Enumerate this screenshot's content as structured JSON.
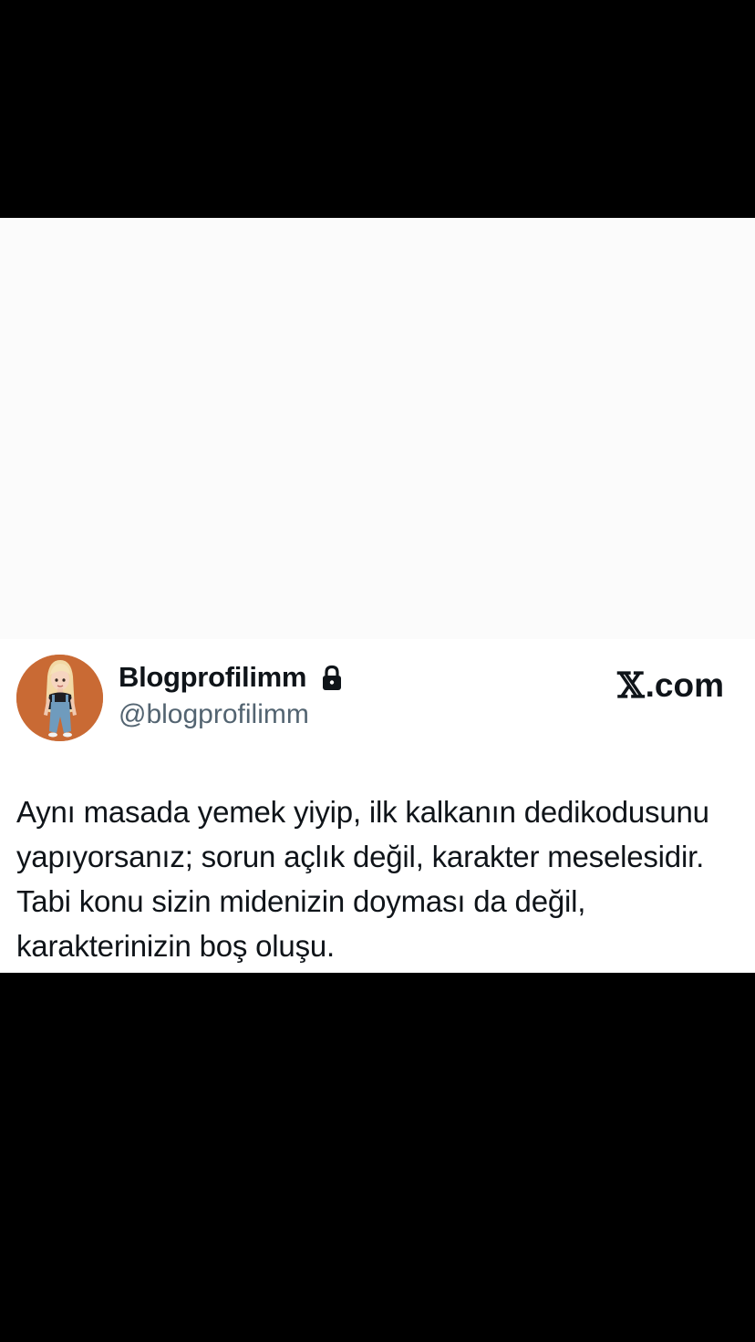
{
  "tweet": {
    "author_name": "Blogprofilimm",
    "author_handle": "@blogprofilimm",
    "brand": ".com",
    "brand_mark": "𝕏",
    "text": "Aynı masada yemek yiyip, ilk kalkanın dedikodusunu yapıyorsanız; sorun açlık değil, karakter meselesidir. Tabi konu sizin midenizin doyması da değil, karakterinizin boş oluşu.",
    "icons": {
      "avatar": "avatar-image",
      "protected": "lock-icon"
    }
  },
  "colors": {
    "avatar_bg": "#c96a34",
    "text_primary": "#0f1419",
    "text_secondary": "#536471"
  }
}
